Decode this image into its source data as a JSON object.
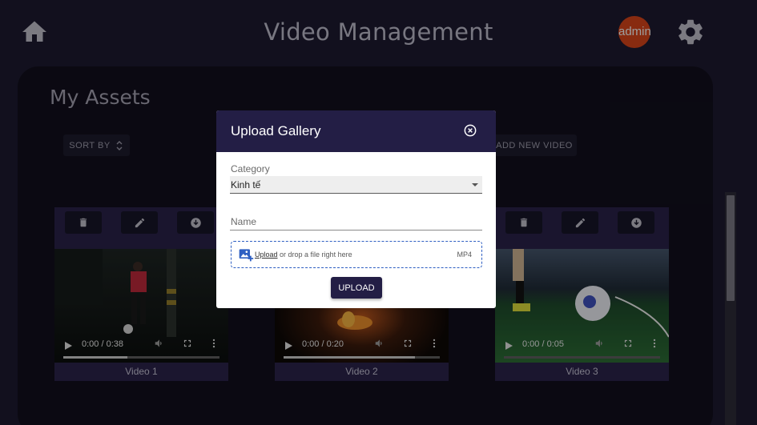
{
  "header": {
    "title": "Video Management",
    "avatar_text": "admin",
    "icons": {
      "home": "home-icon",
      "settings": "gear-icon"
    },
    "avatar_color": "#d1421a"
  },
  "main": {
    "title": "My Assets",
    "sort_label": "SORT BY",
    "add_label": "ADD NEW VIDEO"
  },
  "videos": [
    {
      "label": "Video 1",
      "time": "0:00 / 0:38",
      "progress": 0.41
    },
    {
      "label": "Video 2",
      "time": "0:00 / 0:20",
      "progress": 0.84
    },
    {
      "label": "Video 3",
      "time": "0:00 / 0:05",
      "progress": 0.0
    }
  ],
  "modal": {
    "title": "Upload Gallery",
    "category_label": "Category",
    "category_value": "Kinh tế",
    "name_placeholder": "Name",
    "drop_link": "Upload",
    "drop_text": " or drop a file right here",
    "drop_format": "MP4",
    "upload_label": "UPLOAD"
  },
  "colors": {
    "background": "#1c1a2e",
    "panel": "#110f1c",
    "accent": "#231e45",
    "dropzone_border": "#2e5fc2"
  }
}
